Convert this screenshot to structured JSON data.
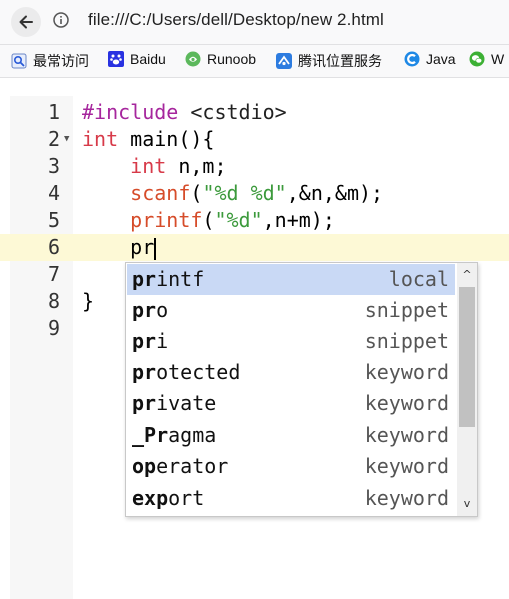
{
  "browser": {
    "url": "file:///C:/Users/dell/Desktop/new 2.html"
  },
  "bookmarks": [
    {
      "label": "最常访问",
      "icon": "most-visited-icon"
    },
    {
      "label": "Baidu",
      "icon": "baidu-paw-icon"
    },
    {
      "label": "Runoob",
      "icon": "runoob-icon"
    },
    {
      "label": "腾讯位置服务",
      "icon": "tencent-map-icon"
    },
    {
      "label": "Java",
      "icon": "java-c-icon"
    },
    {
      "label": "W",
      "icon": "wechat-icon"
    }
  ],
  "editor": {
    "line_numbers": [
      "1",
      "2",
      "3",
      "4",
      "5",
      "6",
      "7",
      "8",
      "9"
    ],
    "lines": [
      {
        "text": "#include <cstdio>"
      },
      {
        "text": "int main(){"
      },
      {
        "text": "    int n,m;"
      },
      {
        "text": "    scanf(\"%d %d\",&n,&m);"
      },
      {
        "text": "    printf(\"%d\",n+m);"
      },
      {
        "text": "    pr"
      },
      {
        "text": ""
      },
      {
        "text": "}"
      },
      {
        "text": ""
      }
    ],
    "active_line": 6
  },
  "autocomplete": {
    "items": [
      {
        "prefix": "pr",
        "rest": "intf",
        "kind": "local"
      },
      {
        "prefix": "pr",
        "rest": "o",
        "kind": "snippet"
      },
      {
        "prefix": "pr",
        "rest": "i",
        "kind": "snippet"
      },
      {
        "prefix": "pr",
        "rest": "otected",
        "kind": "keyword"
      },
      {
        "prefix": "pr",
        "rest": "ivate",
        "kind": "keyword"
      },
      {
        "prefix": "_Pr",
        "rest": "agma",
        "kind": "keyword"
      },
      {
        "prefix": "op",
        "rest": "erator",
        "kind": "keyword"
      },
      {
        "prefix": "exp",
        "rest": "ort",
        "kind": "keyword"
      }
    ],
    "selected_index": 0
  }
}
